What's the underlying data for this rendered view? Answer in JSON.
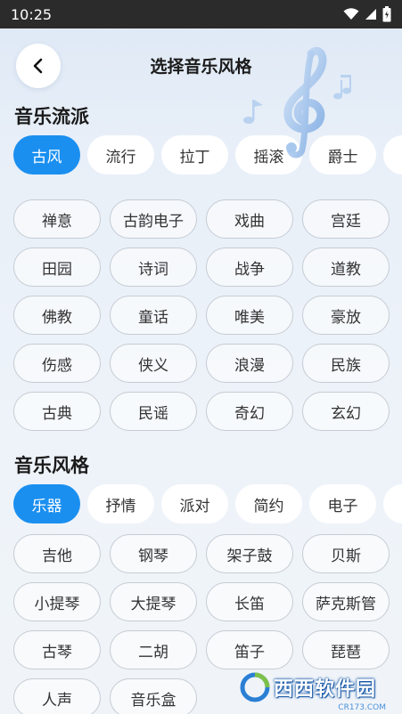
{
  "status_bar": {
    "time": "10:25"
  },
  "header": {
    "title": "选择音乐风格"
  },
  "sections": [
    {
      "title": "音乐流派",
      "tabs": [
        "古风",
        "流行",
        "拉丁",
        "摇滚",
        "爵士"
      ],
      "active_tab": "古风",
      "chips": [
        "禅意",
        "古韵电子",
        "戏曲",
        "宫廷",
        "田园",
        "诗词",
        "战争",
        "道教",
        "佛教",
        "童话",
        "唯美",
        "豪放",
        "伤感",
        "侠义",
        "浪漫",
        "民族",
        "古典",
        "民谣",
        "奇幻",
        "玄幻"
      ]
    },
    {
      "title": "音乐风格",
      "tabs": [
        "乐器",
        "抒情",
        "派对",
        "简约",
        "电子"
      ],
      "active_tab": "乐器",
      "chips": [
        "吉他",
        "钢琴",
        "架子鼓",
        "贝斯",
        "小提琴",
        "大提琴",
        "长笛",
        "萨克斯管",
        "古琴",
        "二胡",
        "笛子",
        "琵琶",
        "人声",
        "音乐盒"
      ]
    }
  ],
  "watermark": {
    "text": "西西软件园",
    "sub": "CR173.COM"
  },
  "colors": {
    "accent": "#1a8ff0",
    "chip_border": "#c6ccd4"
  },
  "icons": [
    "wifi-icon",
    "signal-icon",
    "battery-icon",
    "back-chevron-icon",
    "treble-clef-icon"
  ]
}
